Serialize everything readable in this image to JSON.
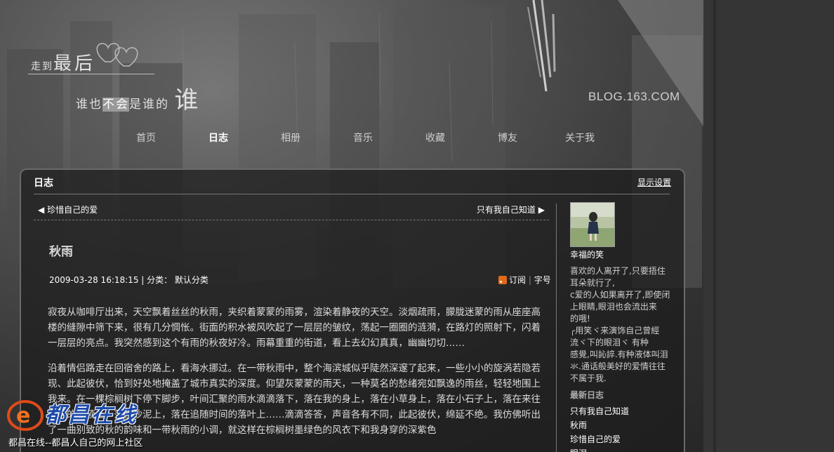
{
  "logo": {
    "line1_small": "走到",
    "line1_big": "最后",
    "line2_a": "谁也",
    "line2_hl": "不会",
    "line2_b": "是谁的",
    "line2_big": "谁"
  },
  "blog_mark": "BLOG.163.COM",
  "nav": [
    "首页",
    "日志",
    "相册",
    "音乐",
    "收藏",
    "博友",
    "关于我"
  ],
  "panel": {
    "title": "日志",
    "settings_link": "显示设置"
  },
  "post_nav": {
    "prev": "珍惜自己的爱",
    "next": "只有我自己知道"
  },
  "post": {
    "title": "秋雨",
    "meta": "2009-03-28 16:18:15 | 分类：  默认分类",
    "subscribe": "订阅",
    "font_size": "字号",
    "paragraphs": [
      "  寂夜从咖啡厅出来，天空飘着丝丝的秋雨，夹织着蒙蒙的雨雾，渲染着静夜的天空。淡烟疏雨，朦胧迷蒙的雨从座座高楼的缝隙中筛下来，很有几分惆怅。街面的积水被风吹起了一层层的皱纹，荡起一圈圈的涟漪，在路灯的照射下，闪着一层层的亮点。我突然感到这个有雨的秋夜好冷。雨幕重重的街道，看上去幻幻真真，幽幽切切……",
      "      沿着情侣路走在回宿舍的路上，看海水挪过。在一带秋雨中，整个海滨城似乎陡然深邃了起来，一些小小的旋涡若隐若现、此起彼伏，恰到好处地掩盖了城市真实的深度。仰望灰蒙蒙的雨天，一种莫名的愁绪宛如飘逸的雨丝，轻轻地围上我来。在一棵棕榈树下停下脚步，叶间汇聚的雨水滴滴落下，落在我的身上，落在小草身上，落在小石子上，落在来往车辆的车顶上，落在沙泥上，落在追随时间的落叶上……滴滴答答，声音各有不同，此起彼伏，绵延不绝。我仿佛听出了一曲别致的秋的韵味和一带秋雨的小调，就这样在棕榈树墨绿色的风衣下和我身穿的深紫色"
    ]
  },
  "sidebar": {
    "user_name": "幸福的笑",
    "signature_lines": [
      "喜欢的人离开了,只要捂住",
      "耳朵就行了,",
      "c爱的人如果离开了,即使闭",
      "上眼睛,眼泪也会流出来",
      "的哦!",
      "  ╭用笑ヾ来演饰自己曾經",
      "流ヾ下的眼泪ヾ      有种",
      "感覺,叫訫誶.有种液体叫泪",
      "氺.通话般美好的爱情往往",
      "不属于我."
    ],
    "recent_title": "最新日志",
    "recent_posts": [
      "只有我自己知道",
      "秋雨",
      "珍惜自己的爱",
      "眼泪"
    ]
  },
  "watermark": {
    "site": "都昌在线",
    "slogan": "都昌在线--都昌人自己的网上社区"
  },
  "colors": {
    "page_bg": "#3a3a3a",
    "panel_bg": "#1c1c1c",
    "watermark_blue": "#1d4aa8",
    "rss_orange": "#e06a1a"
  }
}
